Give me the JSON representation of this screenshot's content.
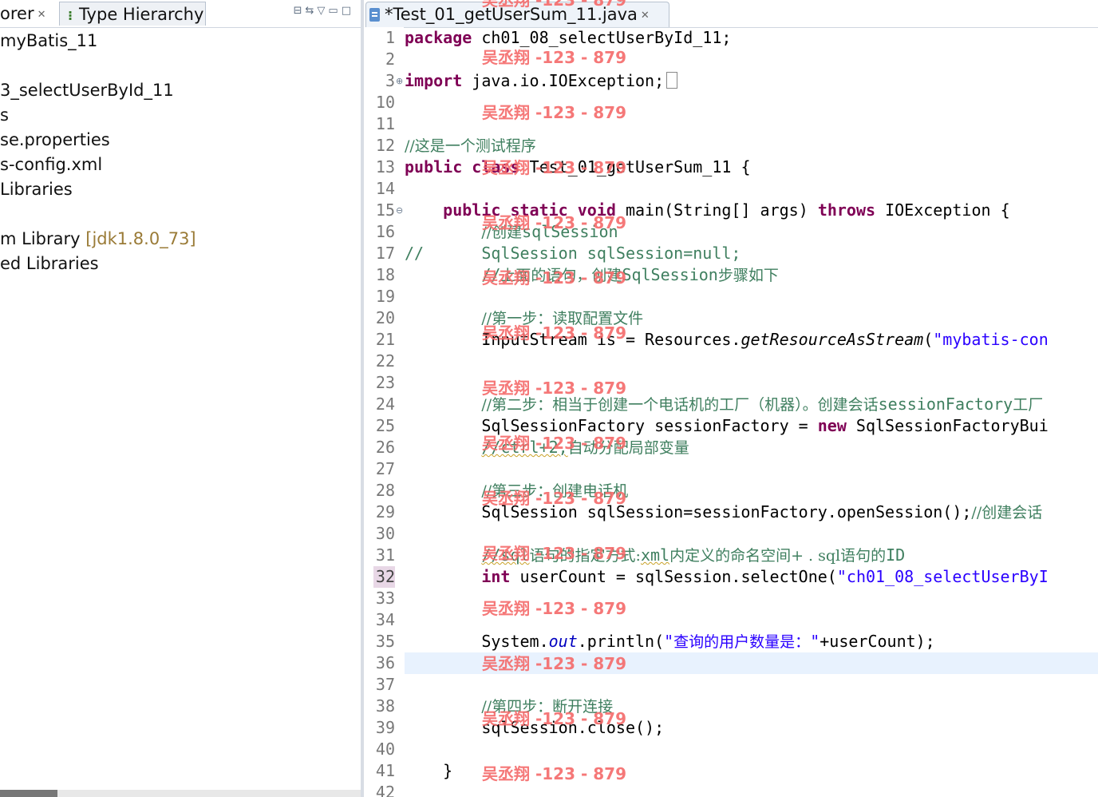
{
  "left_panel": {
    "tab_explorer": "orer",
    "tab_explorer_close": "✕",
    "tab_type_hierarchy": "Type Hierarchy",
    "toolbar_icons": [
      "collapse-all-icon",
      "link-with-editor-icon",
      "view-menu-icon",
      "minimize-icon",
      "maximize-icon"
    ],
    "tree": [
      {
        "text": "myBatis_11",
        "decor": ""
      },
      {
        "text": "",
        "decor": ""
      },
      {
        "text": "3_selectUserById_11",
        "decor": ""
      },
      {
        "text": "s",
        "decor": ""
      },
      {
        "text": "se.properties",
        "decor": ""
      },
      {
        "text": "s-config.xml",
        "decor": ""
      },
      {
        "text": " Libraries",
        "decor": ""
      },
      {
        "text": "",
        "decor": ""
      },
      {
        "text": "m Library ",
        "decor": "[jdk1.8.0_73]"
      },
      {
        "text": "ed Libraries",
        "decor": ""
      }
    ]
  },
  "editor": {
    "tab_title": "*Test_01_getUserSum_11.java",
    "tab_close": "✕",
    "current_line": "36",
    "highlight_line_number": "32",
    "line_numbers": [
      "1",
      "2",
      "3",
      "10",
      "11",
      "12",
      "13",
      "14",
      "15",
      "16",
      "17",
      "18",
      "19",
      "20",
      "21",
      "22",
      "23",
      "24",
      "25",
      "26",
      "27",
      "28",
      "29",
      "30",
      "31",
      "32",
      "33",
      "34",
      "35",
      "36",
      "37",
      "38",
      "39",
      "40",
      "41",
      "42"
    ],
    "code": {
      "l1_kw": "package",
      "l1_rest": " ch01_08_selectUserById_11;",
      "l3_kw": "import",
      "l3_rest": " java.io.IOException;",
      "l12": "//这是一个测试程序",
      "l13_kw1": "public",
      "l13_kw2": "class",
      "l13_rest": " Test_01_getUserSum_11 {",
      "l15_kw1": "public",
      "l15_kw2": "static",
      "l15_kw3": "void",
      "l15_mid": " main(String[] args) ",
      "l15_kw4": "throws",
      "l15_rest": " IOException {",
      "l16_a": "//创建",
      "l16_b": "sqlSession",
      "l17_a": "//",
      "l17_b": "SqlSession sqlSession=null;",
      "l18_a": "//",
      "l18_b": "上面的语句，创建",
      "l18_c": "SqlSession",
      "l18_d": "步骤如下",
      "l20": "//第一步：读取配置文件",
      "l21_a": "InputStream is = Resources.",
      "l21_b": "getResourceAsStream",
      "l21_c": "(",
      "l21_d": "\"mybatis-con",
      "l24_a": "//第二步：相当于创建一个电话机的工厂（机器）。创建会话",
      "l24_b": "sessionFactory",
      "l24_c": "工厂",
      "l25_a": "SqlSessionFactory sessionFactory = ",
      "l25_kw": "new",
      "l25_b": " SqlSessionFactoryBui",
      "l26_a": "//ctrl+2,",
      "l26_b": "自动分配局部变量",
      "l28": "//第三步：创建电话机",
      "l29_a": "SqlSession sqlSession=sessionFactory.openSession();",
      "l29_b": "//创建会话",
      "l31_a": "//sql",
      "l31_b": "语句的指定方式:",
      "l31_c": "xml",
      "l31_d": "内定义的命名空间+ . sql",
      "l31_e": "语句的",
      "l31_f": "ID",
      "l32_kw": "int",
      "l32_a": " userCount = sqlSession.selectOne(",
      "l32_str": "\"ch01_08_selectUserByI",
      "l35_a": "System.",
      "l35_fld": "out",
      "l35_b": ".println(",
      "l35_str1": "\"",
      "l35_str2": "查询的用户数量是：",
      "l35_str3": "\"",
      "l35_c": "+userCount);",
      "l38": "//第四步：断开连接",
      "l39": "sqlSession.close();",
      "l41": "}"
    }
  },
  "watermark": "吴丞翔 -123 - 879"
}
